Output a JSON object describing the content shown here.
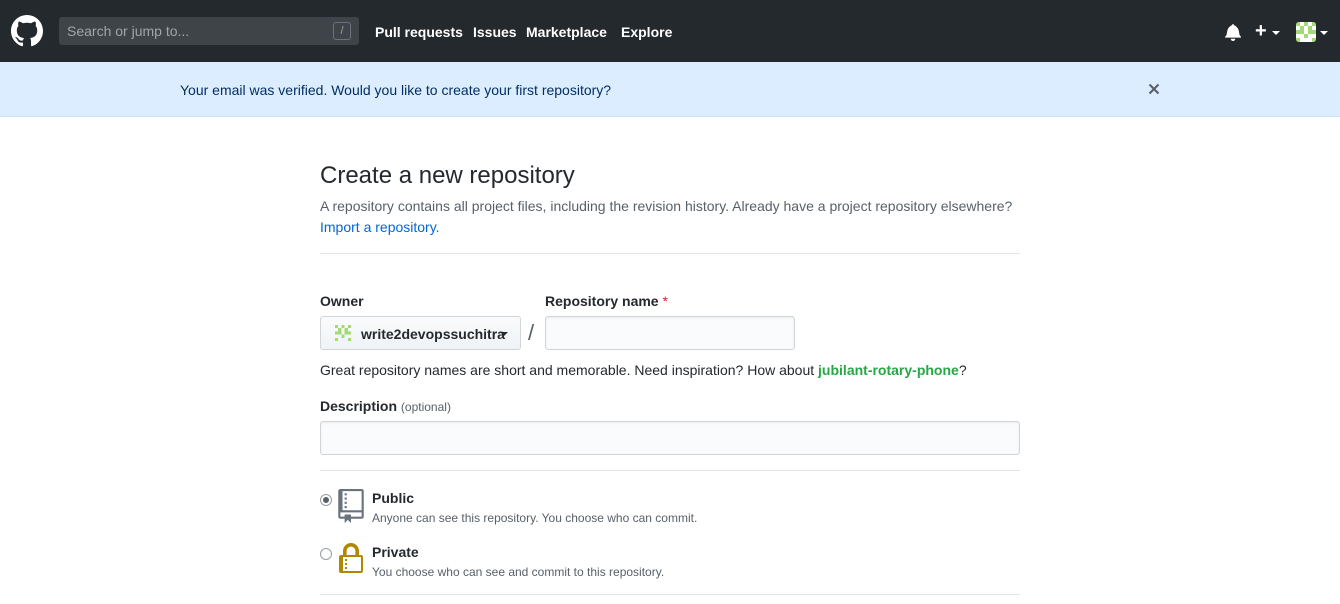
{
  "header": {
    "search_placeholder": "Search or jump to...",
    "search_shortcut": "/",
    "nav": {
      "pull_requests": "Pull requests",
      "issues": "Issues",
      "marketplace": "Marketplace",
      "explore": "Explore"
    },
    "plus_glyph": "+"
  },
  "flash": {
    "message": "Your email was verified. Would you like to create your first repository?"
  },
  "page": {
    "title": "Create a new repository",
    "subtitle": "A repository contains all project files, including the revision history. Already have a project repository elsewhere?",
    "import_link": "Import a repository."
  },
  "form": {
    "owner_label": "Owner",
    "owner_value": "write2devopssuchitra",
    "slash": "/",
    "repo_name_label": "Repository name",
    "required_mark": "*",
    "repo_name_value": "",
    "hint_prefix": "Great repository names are short and memorable. Need inspiration? How about ",
    "hint_suggestion": "jubilant-rotary-phone",
    "hint_suffix": "?",
    "description_label": "Description",
    "description_optional": "(optional)",
    "description_value": "",
    "visibility": {
      "selected": "public",
      "public_title": "Public",
      "public_desc": "Anyone can see this repository. You choose who can commit.",
      "private_title": "Private",
      "private_desc": "You choose who can see and commit to this repository."
    }
  },
  "colors": {
    "header_bg": "#24292e",
    "flash_bg": "#dbedff",
    "link": "#0366d6",
    "suggestion": "#28a745",
    "required": "#cb2431",
    "lock": "#b08800"
  },
  "icons": [
    "github-mark-icon",
    "bell-icon",
    "plus-icon",
    "chevron-down-icon",
    "identicon-avatar",
    "close-icon",
    "repo-icon",
    "lock-icon"
  ]
}
